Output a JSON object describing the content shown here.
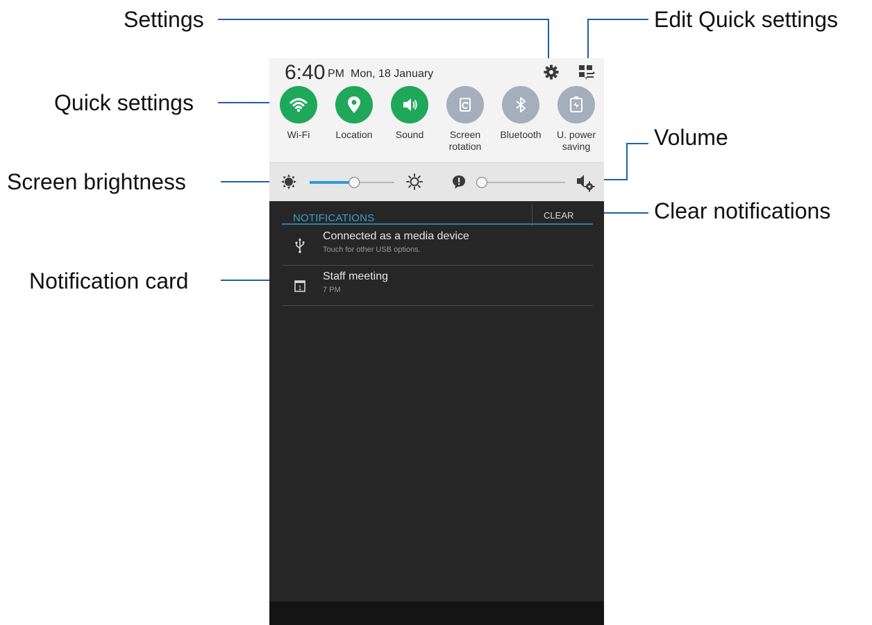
{
  "callouts": {
    "settings": "Settings",
    "edit_quick_settings": "Edit Quick settings",
    "quick_settings": "Quick settings",
    "volume": "Volume",
    "screen_brightness": "Screen brightness",
    "clear_notifications": "Clear notifications",
    "notification_card": "Notification card"
  },
  "status": {
    "time": "6:40",
    "ampm": "PM",
    "date": "Mon, 18 January"
  },
  "quick_settings": [
    {
      "label": "Wi-Fi",
      "icon": "wifi-icon",
      "active": true
    },
    {
      "label": "Location",
      "icon": "location-pin-icon",
      "active": true
    },
    {
      "label": "Sound",
      "icon": "speaker-icon",
      "active": true
    },
    {
      "label": "Screen\nrotation",
      "icon": "screen-rotation-icon",
      "active": false
    },
    {
      "label": "Bluetooth",
      "icon": "bluetooth-icon",
      "active": false
    },
    {
      "label": "U. power\nsaving",
      "icon": "power-saving-icon",
      "active": false
    }
  ],
  "sliders": {
    "brightness_level": 0.53,
    "volume_level": 0.0
  },
  "notifications": {
    "header": "NOTIFICATIONS",
    "clear_label": "CLEAR",
    "items": [
      {
        "title": "Connected as a media device",
        "subtitle": "Touch for other USB options.",
        "icon": "usb-icon"
      },
      {
        "title": "Staff meeting",
        "subtitle": "7 PM",
        "icon": "calendar-icon"
      }
    ]
  },
  "colors": {
    "active_tile": "#1fa85a",
    "inactive_tile": "#a4afbb",
    "accent": "#3a9fcf",
    "leader_line": "#1f5fa6"
  }
}
